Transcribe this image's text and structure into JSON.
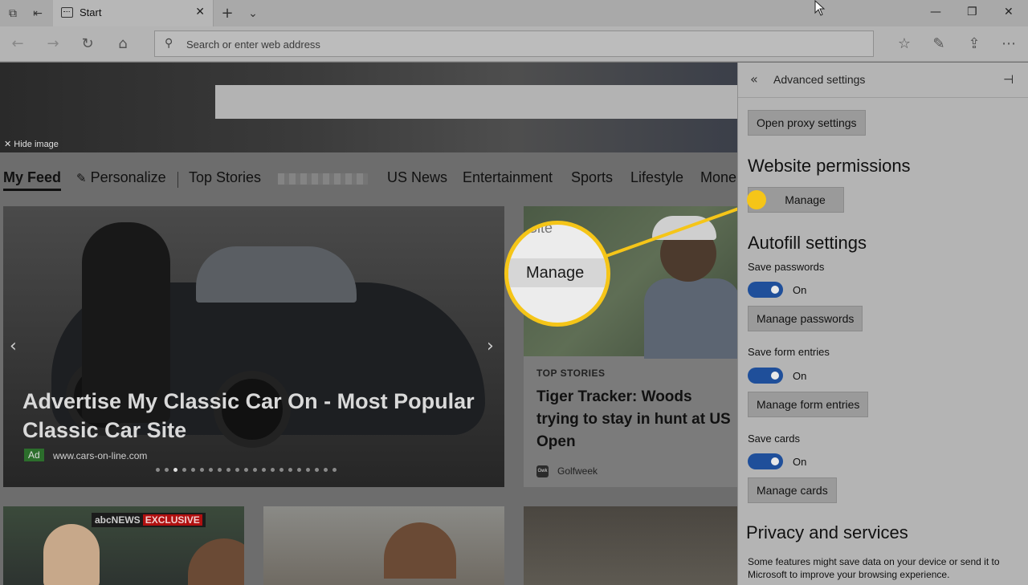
{
  "browser": {
    "tab_title": "Start",
    "address_placeholder": "Search or enter web address"
  },
  "page": {
    "hide_image": "Hide image",
    "feed_tabs": [
      "My Feed",
      "Personalize",
      "Top Stories",
      "US News",
      "Entertainment",
      "Sports",
      "Lifestyle",
      "Mone"
    ],
    "main_card": {
      "headline": "Advertise My Classic Car On - Most Popular Classic Car Site",
      "ad_label": "Ad",
      "url": "www.cars-on-line.com"
    },
    "story_card": {
      "kicker": "TOP STORIES",
      "title": "Tiger Tracker: Woods trying to stay in hunt at US Open",
      "source": "Golfweek",
      "source_icon": "Gwk"
    },
    "thumb_badge": {
      "network": "abcNEWS",
      "tag": "EXCLUSIVE"
    }
  },
  "callout": {
    "top_text": "Site",
    "label": "Manage",
    "accent": "#f5c518"
  },
  "settings": {
    "title": "Advanced settings",
    "proxy_button": "Open proxy settings",
    "website_permissions": {
      "heading": "Website permissions",
      "button": "Manage"
    },
    "autofill": {
      "heading": "Autofill settings",
      "save_passwords": "Save passwords",
      "save_passwords_state": "On",
      "manage_passwords": "Manage passwords",
      "save_form_entries": "Save form entries",
      "save_form_entries_state": "On",
      "manage_form_entries": "Manage form entries",
      "save_cards": "Save cards",
      "save_cards_state": "On",
      "manage_cards": "Manage cards"
    },
    "privacy": {
      "heading": "Privacy and services",
      "description": "Some features might save data on your device or send it to Microsoft to improve your browsing experience."
    },
    "toggle_color": "#1f4f9a"
  }
}
